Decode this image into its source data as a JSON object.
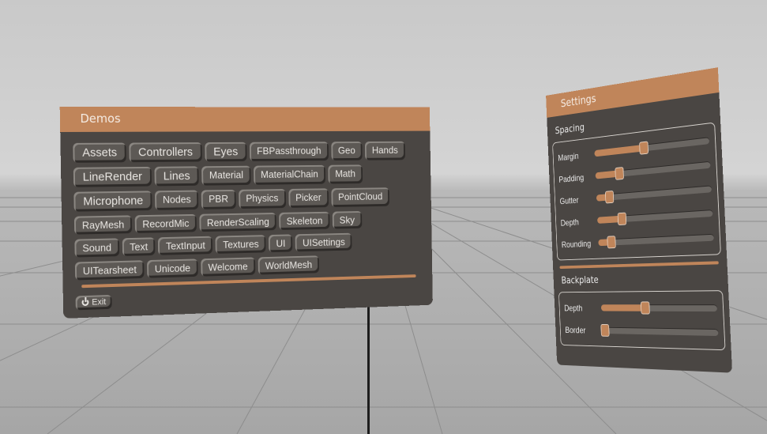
{
  "demos": {
    "title": "Demos",
    "rows": [
      [
        "Assets",
        "Controllers",
        "Eyes",
        "FBPassthrough",
        "Geo",
        "Hands"
      ],
      [
        "LineRender",
        "Lines",
        "Material",
        "MaterialChain",
        "Math"
      ],
      [
        "Microphone",
        "Nodes",
        "PBR",
        "Physics",
        "Picker",
        "PointCloud"
      ],
      [
        "RayMesh",
        "RecordMic",
        "RenderScaling",
        "Skeleton",
        "Sky"
      ],
      [
        "Sound",
        "Text",
        "TextInput",
        "Textures",
        "UI",
        "UISettings"
      ],
      [
        "UITearsheet",
        "Unicode",
        "Welcome",
        "WorldMesh"
      ]
    ],
    "exit_label": "Exit"
  },
  "settings": {
    "title": "Settings",
    "spacing_label": "Spacing",
    "spacing": [
      {
        "label": "Margin",
        "value": 0.45
      },
      {
        "label": "Padding",
        "value": 0.22
      },
      {
        "label": "Gutter",
        "value": 0.12
      },
      {
        "label": "Depth",
        "value": 0.23
      },
      {
        "label": "Rounding",
        "value": 0.12
      }
    ],
    "backplate_label": "Backplate",
    "backplate": [
      {
        "label": "Depth",
        "value": 0.4
      },
      {
        "label": "Border",
        "value": 0.03
      }
    ]
  },
  "colors": {
    "accent": "#c0855a",
    "panel": "#4a4643",
    "button": "#5d5955"
  }
}
